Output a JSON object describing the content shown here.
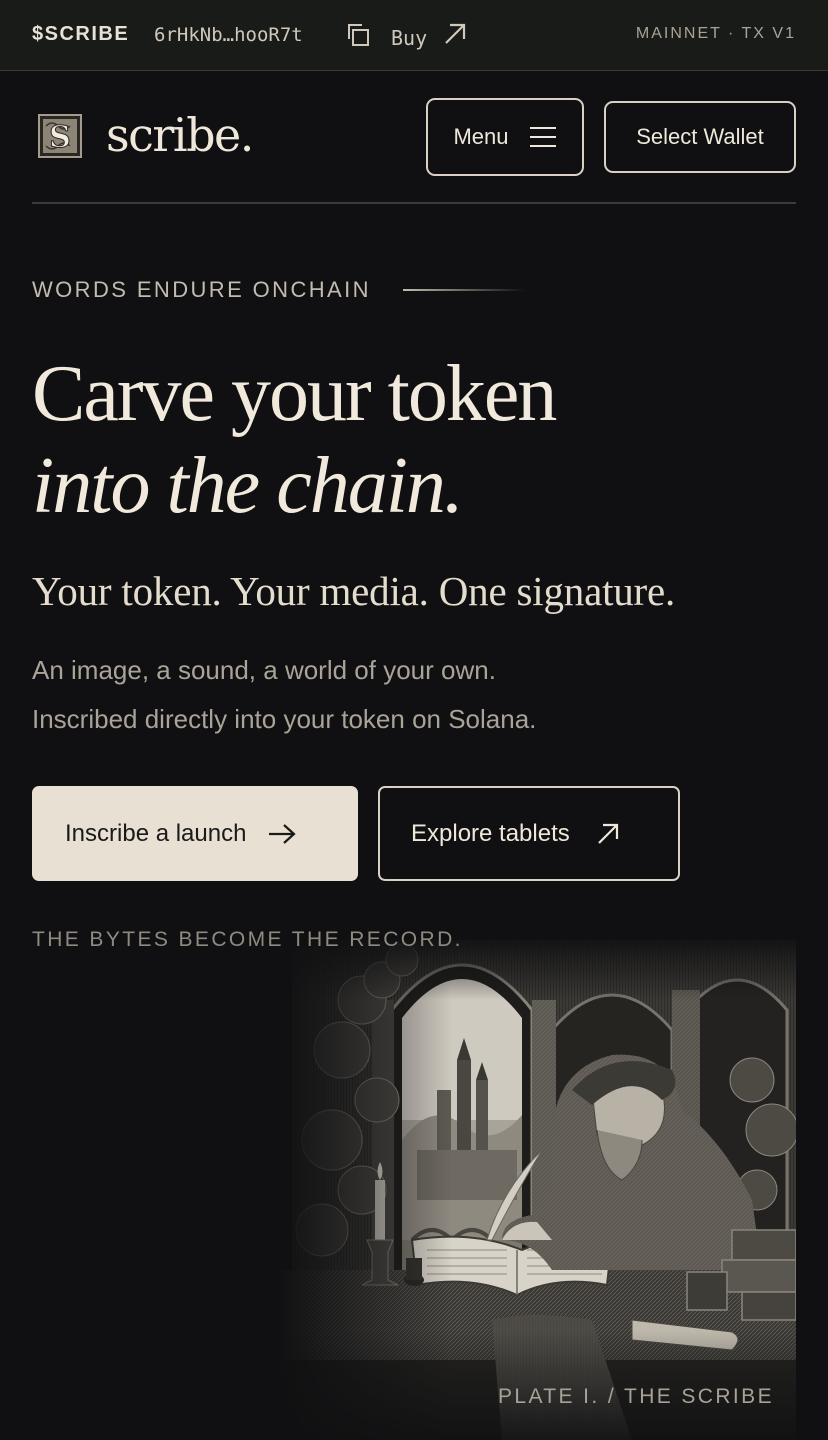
{
  "topbar": {
    "ticker": "$SCRIBE",
    "address": "6rHkNb…hooR7t",
    "buy_label": "Buy",
    "network": "MAINNET · TX V1"
  },
  "header": {
    "logo_text": "scribe.",
    "menu_label": "Menu",
    "wallet_label": "Select Wallet"
  },
  "hero": {
    "eyebrow": "WORDS ENDURE ONCHAIN",
    "headline_line1": "Carve your token",
    "headline_line2": "into the chain.",
    "subhead": "Your token. Your media. One signature.",
    "body_line1": "An image, a sound, a world of your own.",
    "body_line2": "Inscribed directly into your token on Solana.",
    "primary_cta": "Inscribe a launch",
    "secondary_cta": "Explore tablets",
    "caption": "THE BYTES BECOME THE RECORD."
  },
  "plate": {
    "caption": "PLATE I. / THE SCRIBE",
    "logo_letter": "S"
  },
  "colors": {
    "background": "#101012",
    "topbar": "#191b18",
    "ivory": "#e8e0d2",
    "text_muted": "#a9a398"
  }
}
